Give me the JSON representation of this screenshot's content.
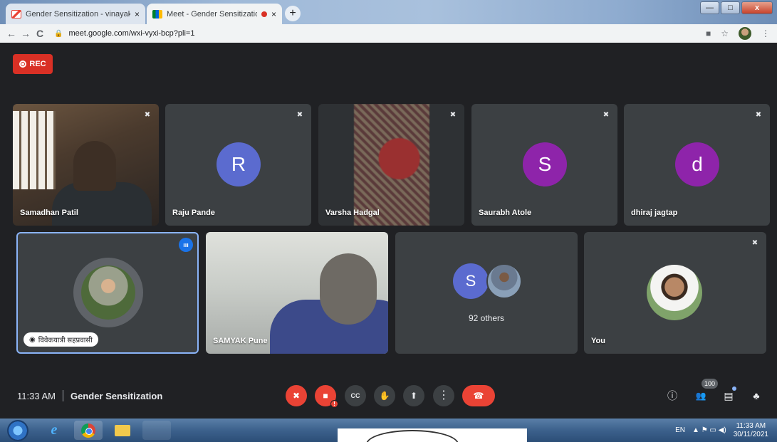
{
  "browser": {
    "tabs": [
      {
        "title": "Gender Sensitization - vinayak.la",
        "close": "×"
      },
      {
        "title": "Meet - Gender Sensitization",
        "close": "×"
      }
    ],
    "new_tab": "+",
    "url": "meet.google.com/wxi-vyxi-bcp?pli=1",
    "back": "←",
    "forward": "→",
    "reload": "C",
    "star": "☆",
    "menu": "⋮",
    "window_controls": {
      "minimize": "—",
      "maximize": "□",
      "close": "x"
    }
  },
  "meet": {
    "rec_label": "REC",
    "participants_row1": [
      {
        "name": "Samadhan Patil",
        "type": "video"
      },
      {
        "name": "Raju Pande",
        "type": "letter",
        "letter": "R",
        "color": "#5b6bcf"
      },
      {
        "name": "Varsha Hadgal",
        "type": "video"
      },
      {
        "name": "Saurabh Atole",
        "type": "letter",
        "letter": "S",
        "color": "#8e24aa"
      },
      {
        "name": "dhiraj jagtap",
        "type": "letter",
        "letter": "d",
        "color": "#8e24aa"
      }
    ],
    "participants_row2": [
      {
        "name": "विवेकयात्री सहप्रवासी",
        "type": "photo",
        "speaking": true
      },
      {
        "name": "SAMYAK Pune",
        "type": "video"
      },
      {
        "name": "92 others",
        "type": "group",
        "letter": "S"
      },
      {
        "name": "You",
        "type": "photo"
      }
    ],
    "mute_icon": "✖",
    "speaking_icon": "ııı",
    "time": "11:33 AM",
    "meeting_title": "Gender Sensitization",
    "participant_count": "100",
    "controls": [
      {
        "name": "mic-off-button",
        "glyph": "✖",
        "red": true
      },
      {
        "name": "camera-off-button",
        "glyph": "■",
        "red": true
      },
      {
        "name": "captions-button",
        "glyph": "CC",
        "red": false
      },
      {
        "name": "raise-hand-button",
        "glyph": "✋",
        "red": false
      },
      {
        "name": "present-button",
        "glyph": "⬆",
        "red": false
      },
      {
        "name": "more-options-button",
        "glyph": "⋮",
        "red": false
      }
    ],
    "end_call_glyph": "☎",
    "right_icons": {
      "info": "ⓘ",
      "people": "👥",
      "chat": "▤",
      "activities": "♣"
    }
  },
  "taskbar": {
    "lang": "EN",
    "tray_icons": "▲  ⚑  ▭  ◀)",
    "clock_time": "11:33 AM",
    "clock_date": "30/11/2021"
  },
  "colors": {
    "meet_bg": "#202124",
    "tile_bg": "#3c4043",
    "rec_red": "#d93025",
    "speaking_blue": "#8ab4f8"
  }
}
